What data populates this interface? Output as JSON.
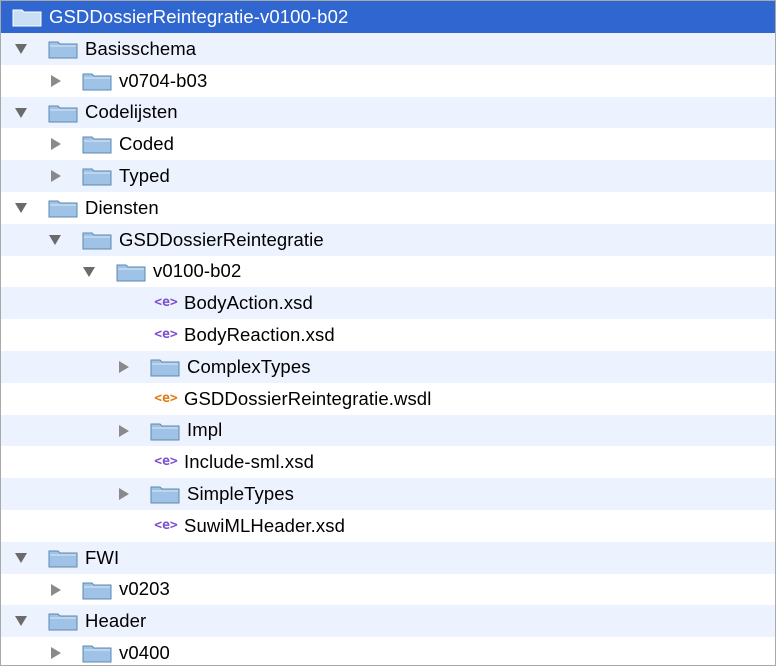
{
  "tree": {
    "root": {
      "label": "GSDDossierReintegratie-v0100-b02",
      "icon": "folder-icon"
    },
    "nodes": [
      {
        "label": "Basisschema",
        "type": "folder",
        "state": "expanded",
        "depth": 0
      },
      {
        "label": "v0704-b03",
        "type": "folder",
        "state": "collapsed",
        "depth": 1
      },
      {
        "label": "Codelijsten",
        "type": "folder",
        "state": "expanded",
        "depth": 0
      },
      {
        "label": "Coded",
        "type": "folder",
        "state": "collapsed",
        "depth": 1
      },
      {
        "label": "Typed",
        "type": "folder",
        "state": "collapsed",
        "depth": 1
      },
      {
        "label": "Diensten",
        "type": "folder",
        "state": "expanded",
        "depth": 0
      },
      {
        "label": "GSDDossierReintegratie",
        "type": "folder",
        "state": "expanded",
        "depth": 1
      },
      {
        "label": "v0100-b02",
        "type": "folder",
        "state": "expanded",
        "depth": 2
      },
      {
        "label": "BodyAction.xsd",
        "type": "xsd",
        "state": "leaf",
        "depth": 3
      },
      {
        "label": "BodyReaction.xsd",
        "type": "xsd",
        "state": "leaf",
        "depth": 3
      },
      {
        "label": "ComplexTypes",
        "type": "folder",
        "state": "collapsed",
        "depth": 3
      },
      {
        "label": "GSDDossierReintegratie.wsdl",
        "type": "wsdl",
        "state": "leaf",
        "depth": 3
      },
      {
        "label": "Impl",
        "type": "folder",
        "state": "collapsed",
        "depth": 3
      },
      {
        "label": "Include-sml.xsd",
        "type": "xsd",
        "state": "leaf",
        "depth": 3
      },
      {
        "label": "SimpleTypes",
        "type": "folder",
        "state": "collapsed",
        "depth": 3
      },
      {
        "label": "SuwiMLHeader.xsd",
        "type": "xsd",
        "state": "leaf",
        "depth": 3
      },
      {
        "label": "FWI",
        "type": "folder",
        "state": "expanded",
        "depth": 0
      },
      {
        "label": "v0203",
        "type": "folder",
        "state": "collapsed",
        "depth": 1
      },
      {
        "label": "Header",
        "type": "folder",
        "state": "expanded",
        "depth": 0
      },
      {
        "label": "v0400",
        "type": "folder",
        "state": "collapsed",
        "depth": 1
      }
    ]
  },
  "icons": {
    "folder_fill": "#9fc3e6",
    "folder_stroke": "#5f87b0",
    "file_glyph": "<e>"
  },
  "colors": {
    "selection": "#2f66cf",
    "alternate_row": "#edf3fe"
  }
}
